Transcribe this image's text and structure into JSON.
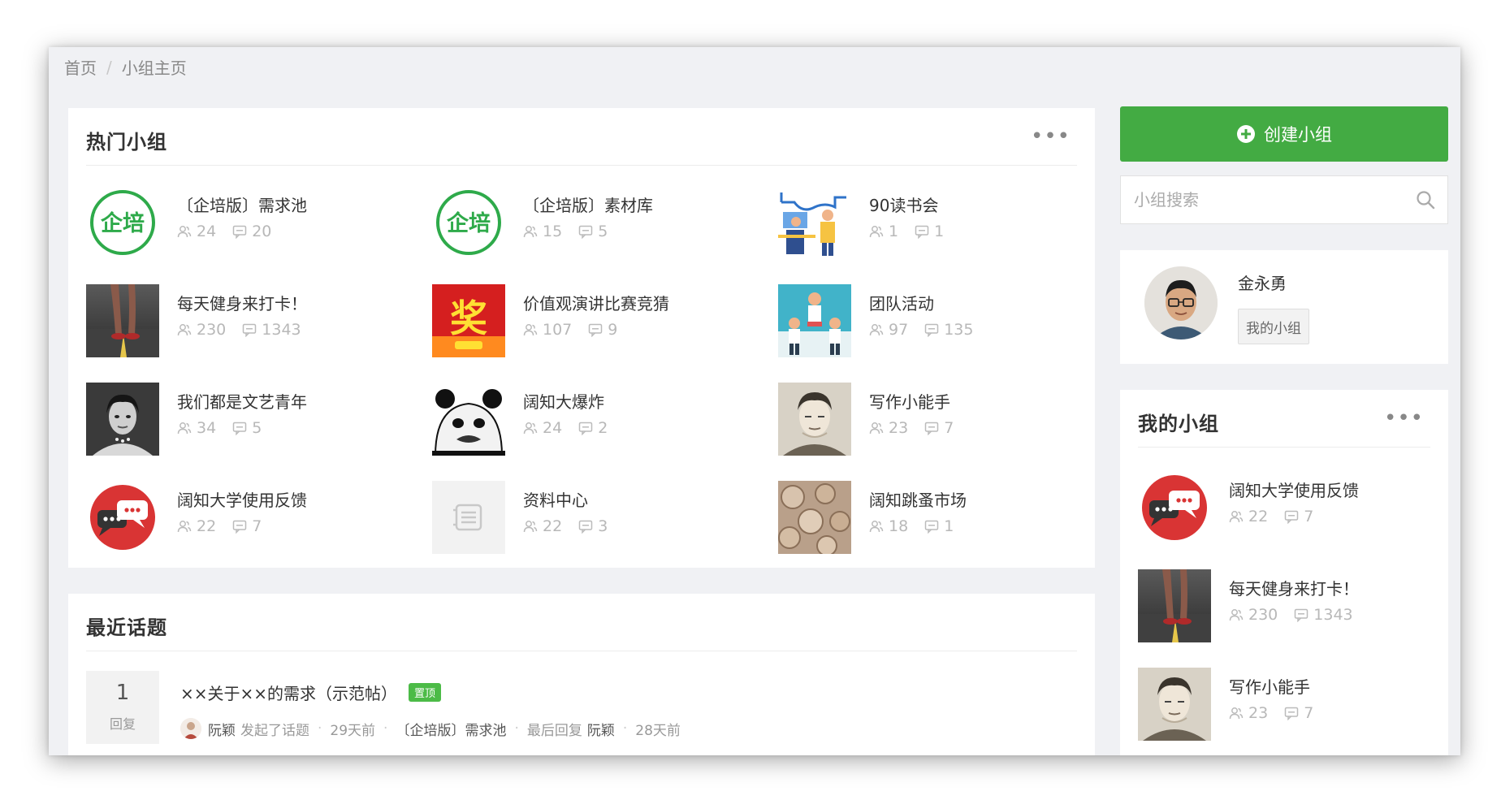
{
  "breadcrumb": {
    "items": [
      "首页",
      "小组主页"
    ],
    "separator": "/"
  },
  "hot_groups": {
    "title": "热门小组",
    "more_label": "•••",
    "groups": [
      {
        "name": "〔企培版〕需求池",
        "members": "24",
        "topics": "20",
        "thumb": "logo-qipei"
      },
      {
        "name": "〔企培版〕素材库",
        "members": "15",
        "topics": "5",
        "thumb": "logo-qipei"
      },
      {
        "name": "90读书会",
        "members": "1",
        "topics": "1",
        "thumb": "illustration-reading"
      },
      {
        "name": "每天健身来打卡！",
        "members": "230",
        "topics": "1343",
        "thumb": "photo-running"
      },
      {
        "name": "价值观演讲比赛竞猜",
        "members": "107",
        "topics": "9",
        "thumb": "prize-banner"
      },
      {
        "name": "团队活动",
        "members": "97",
        "topics": "135",
        "thumb": "illustration-team"
      },
      {
        "name": "我们都是文艺青年",
        "members": "34",
        "topics": "5",
        "thumb": "photo-portrait-bw"
      },
      {
        "name": "阔知大爆炸",
        "members": "24",
        "topics": "2",
        "thumb": "panda-meme"
      },
      {
        "name": "写作小能手",
        "members": "23",
        "topics": "7",
        "thumb": "portrait-drawing"
      },
      {
        "name": "阔知大学使用反馈",
        "members": "22",
        "topics": "7",
        "thumb": "chat-bubbles"
      },
      {
        "name": "资料中心",
        "members": "22",
        "topics": "3",
        "thumb": "placeholder-doc"
      },
      {
        "name": "阔知跳蚤市场",
        "members": "18",
        "topics": "1",
        "thumb": "photo-coins"
      }
    ]
  },
  "recent_topics": {
    "title": "最近话题",
    "topics": [
      {
        "reply_count": "1",
        "reply_label": "回复",
        "title": "××关于××的需求（示范帖）",
        "badge": "置顶",
        "author": "阮颖",
        "action": "发起了话题",
        "time": "29天前",
        "group": "〔企培版〕需求池",
        "last_reply_label": "最后回复",
        "last_replier": "阮颖",
        "last_reply_time": "28天前"
      }
    ]
  },
  "sidebar": {
    "create_label": "创建小组",
    "search_placeholder": "小组搜索",
    "user": {
      "name": "金永勇",
      "my_group_label": "我的小组"
    },
    "my_groups": {
      "title": "我的小组",
      "more_label": "•••",
      "groups": [
        {
          "name": "阔知大学使用反馈",
          "members": "22",
          "topics": "7",
          "thumb": "chat-bubbles"
        },
        {
          "name": "每天健身来打卡！",
          "members": "230",
          "topics": "1343",
          "thumb": "photo-running"
        },
        {
          "name": "写作小能手",
          "members": "23",
          "topics": "7",
          "thumb": "portrait-drawing"
        }
      ]
    }
  },
  "colors": {
    "primary_green": "#43ab43",
    "badge_green": "#4cbb47",
    "page_bg": "#f0f1f4"
  }
}
